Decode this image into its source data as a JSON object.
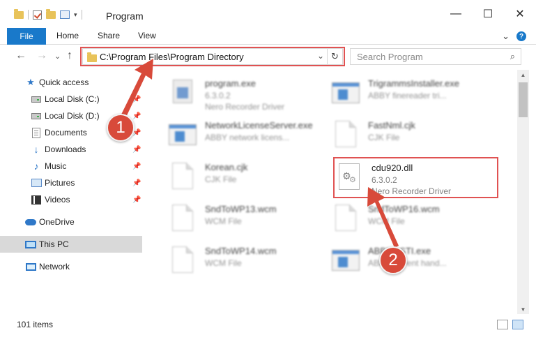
{
  "window": {
    "title": "Program",
    "controls": {
      "minimize": "—",
      "maximize": "☐",
      "close": "✕"
    }
  },
  "ribbon": {
    "file_label": "File",
    "tabs": [
      "Home",
      "Share",
      "View"
    ],
    "expand_glyph": "⌄",
    "help_glyph": "?"
  },
  "navigation": {
    "back_glyph": "←",
    "forward_glyph": "→",
    "recent_glyph": "⌄",
    "up_glyph": "↑",
    "address": "C:\\Program Files\\Program Directory",
    "refresh_glyph": "↻",
    "search_placeholder": "Search Program",
    "search_glyph": "⌕"
  },
  "sidebar": {
    "items": [
      {
        "label": "Quick access",
        "icon": "star-icon",
        "pinned": false,
        "selected": false
      },
      {
        "label": "Local Disk (C:)",
        "icon": "disk-icon",
        "pinned": true,
        "selected": false
      },
      {
        "label": "Local Disk (D:)",
        "icon": "disk-icon",
        "pinned": true,
        "selected": false
      },
      {
        "label": "Documents",
        "icon": "documents-icon",
        "pinned": true,
        "selected": false
      },
      {
        "label": "Downloads",
        "icon": "download-icon",
        "pinned": true,
        "selected": false
      },
      {
        "label": "Music",
        "icon": "music-icon",
        "pinned": true,
        "selected": false
      },
      {
        "label": "Pictures",
        "icon": "pictures-icon",
        "pinned": true,
        "selected": false
      },
      {
        "label": "Videos",
        "icon": "videos-icon",
        "pinned": true,
        "selected": false
      },
      {
        "label": "OneDrive",
        "icon": "cloud-icon",
        "pinned": false,
        "selected": false
      },
      {
        "label": "This PC",
        "icon": "computer-icon",
        "pinned": false,
        "selected": true
      },
      {
        "label": "Network",
        "icon": "network-icon",
        "pinned": false,
        "selected": false
      }
    ],
    "pin_glyph": "📌"
  },
  "files": [
    {
      "name": "program.exe",
      "line2": "6.3.0.2",
      "line3": "Nero Recorder Driver",
      "icon": "exe-icon",
      "blurred": true
    },
    {
      "name": "TrigrammsInstaller.exe",
      "line2": "ABBY finereader tri...",
      "line3": "",
      "icon": "app-icon",
      "blurred": true
    },
    {
      "name": "NetworkLicenseServer.exe",
      "line2": "ABBY network licens...",
      "line3": "",
      "icon": "app-icon",
      "blurred": true
    },
    {
      "name": "FastNml.cjk",
      "line2": "CJK File",
      "line3": "",
      "icon": "file-icon",
      "blurred": true
    },
    {
      "name": "Korean.cjk",
      "line2": "CJK File",
      "line3": "",
      "icon": "file-icon",
      "blurred": true
    },
    {
      "name": "cdu920.dll",
      "line2": "6.3.0.2",
      "line3": "Nero Recorder Driver",
      "icon": "dll-icon",
      "blurred": false
    },
    {
      "name": "SndToWP13.wcm",
      "line2": "WCM File",
      "line3": "",
      "icon": "file-icon",
      "blurred": true
    },
    {
      "name": "SndToWP16.wcm",
      "line2": "WCM File",
      "line3": "",
      "icon": "file-icon",
      "blurred": true
    },
    {
      "name": "SndToWP14.wcm",
      "line2": "WCM File",
      "line3": "",
      "icon": "file-icon",
      "blurred": true
    },
    {
      "name": "ABBYY.STI.exe",
      "line2": "ABBYY event hand...",
      "line3": "",
      "icon": "app-icon",
      "blurred": true
    }
  ],
  "status": {
    "count": "101 items"
  },
  "callouts": [
    {
      "number": "1",
      "color": "#d84a3a"
    },
    {
      "number": "2",
      "color": "#d84a3a"
    }
  ],
  "colors": {
    "accent": "#1979ca",
    "highlight": "#e05252",
    "selected_bg": "#d9d9d9"
  }
}
